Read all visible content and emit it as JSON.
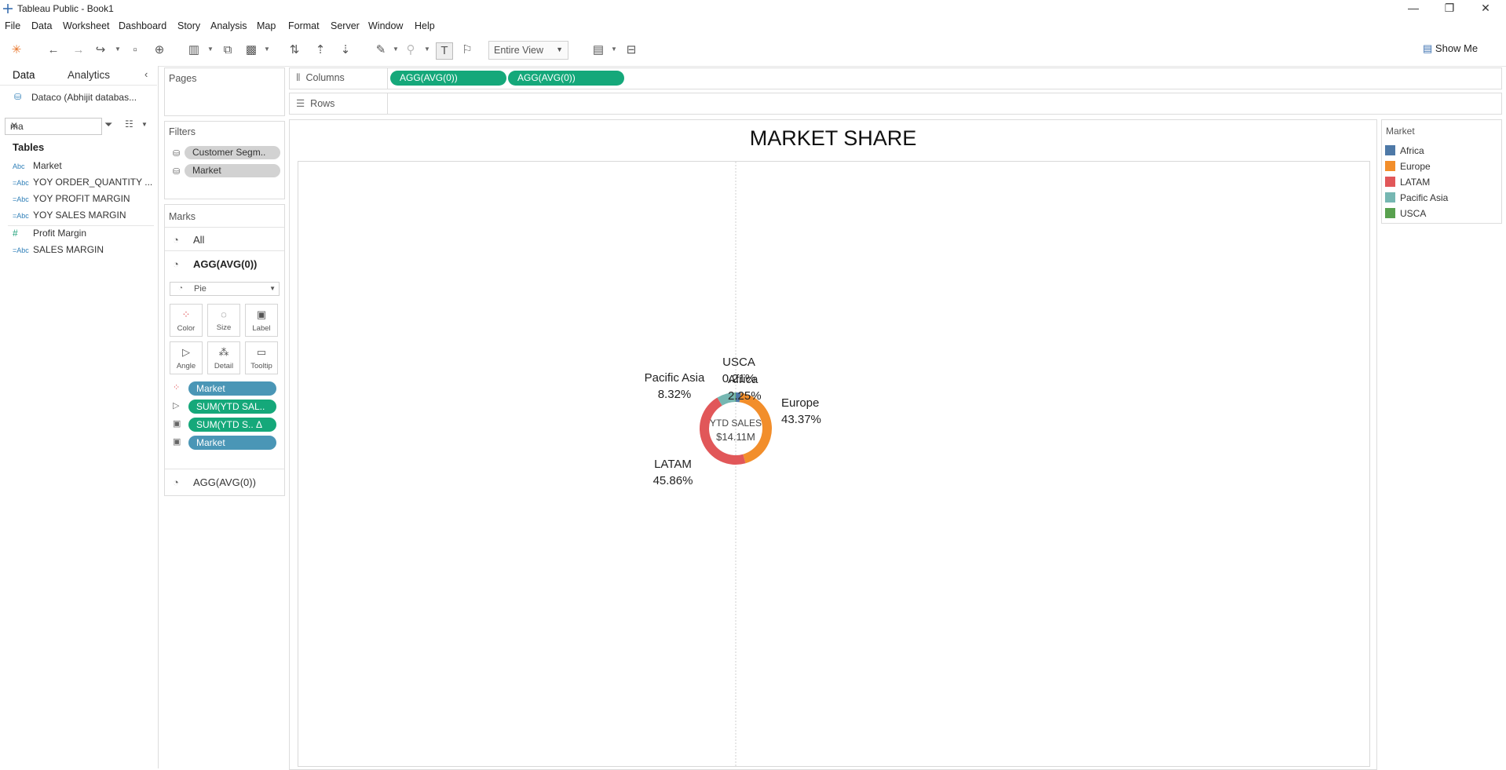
{
  "window": {
    "title": "Tableau Public - Book1",
    "controls": [
      "—",
      "❐",
      "✕"
    ]
  },
  "menu": [
    "File",
    "Data",
    "Worksheet",
    "Dashboard",
    "Story",
    "Analysis",
    "Map",
    "Format",
    "Server",
    "Window",
    "Help"
  ],
  "toolbar": {
    "fit": "Entire View",
    "show_me": "Show Me"
  },
  "data_pane": {
    "tabs": [
      "Data",
      "Analytics"
    ],
    "datasource": "Dataco (Abhijit databas...",
    "search_value": "ma",
    "tables_heading": "Tables",
    "fields": [
      {
        "type": "Abc",
        "name": "Market"
      },
      {
        "type": "=Abc",
        "name": "YOY ORDER_QUANTITY ..."
      },
      {
        "type": "=Abc",
        "name": "YOY PROFIT MARGIN"
      },
      {
        "type": "=Abc",
        "name": "YOY SALES MARGIN"
      },
      {
        "type": "#",
        "name": "Profit Margin"
      },
      {
        "type": "=Abc",
        "name": "SALES MARGIN"
      }
    ]
  },
  "pages": {
    "title": "Pages"
  },
  "filters": {
    "title": "Filters",
    "items": [
      "Customer Segm..",
      "Market"
    ]
  },
  "marks": {
    "title": "Marks",
    "all_label": "All",
    "card1": "AGG(AVG(0))",
    "mark_type": "Pie",
    "buttons": [
      "Color",
      "Size",
      "Label",
      "Angle",
      "Detail",
      "Tooltip"
    ],
    "pills": [
      "Market",
      "SUM(YTD SAL..",
      "SUM(YTD S.. Δ",
      "Market"
    ],
    "card2": "AGG(AVG(0))"
  },
  "shelves": {
    "columns_label": "Columns",
    "rows_label": "Rows",
    "columns_pills": [
      "AGG(AVG(0))",
      "AGG(AVG(0))"
    ]
  },
  "view": {
    "title": "MARKET SHARE",
    "center_label_1": "YTD SALES",
    "center_label_2": "$14.11M"
  },
  "legend": {
    "title": "Market",
    "items": [
      {
        "name": "Africa",
        "color": "#4e79a7"
      },
      {
        "name": "Europe",
        "color": "#f28e2b"
      },
      {
        "name": "LATAM",
        "color": "#e15759"
      },
      {
        "name": "Pacific Asia",
        "color": "#76b7b2"
      },
      {
        "name": "USCA",
        "color": "#59a14f"
      }
    ]
  },
  "chart_data": {
    "type": "pie",
    "title": "MARKET SHARE",
    "categories": [
      "Africa",
      "Europe",
      "LATAM",
      "Pacific Asia",
      "USCA"
    ],
    "values": [
      2.25,
      43.37,
      45.86,
      8.32,
      0.21
    ],
    "labels": [
      "2.25%",
      "43.37%",
      "45.86%",
      "8.32%",
      "0.21%"
    ],
    "colors": [
      "#4e79a7",
      "#f28e2b",
      "#e15759",
      "#76b7b2",
      "#59a14f"
    ],
    "donut": true
  }
}
